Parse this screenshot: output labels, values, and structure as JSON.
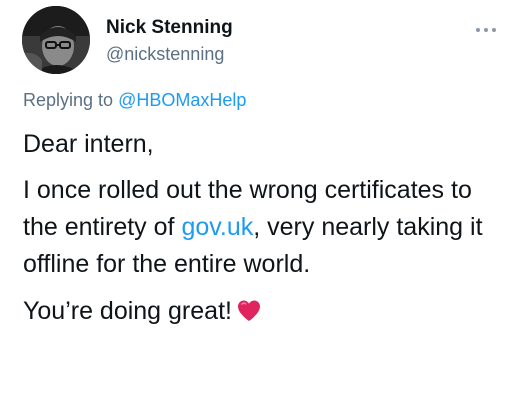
{
  "author": {
    "name": "Nick Stenning",
    "handle": "@nickstenning"
  },
  "reply": {
    "prefix": "Replying to",
    "mention": "@HBOMaxHelp"
  },
  "body": {
    "greeting": "Dear intern,",
    "para1_before_link": "I once rolled out the wrong certificates to the entirety of ",
    "link_text": "gov.uk",
    "para1_after_link": ", very nearly taking it offline for the entire world.",
    "closing": "You’re doing great!",
    "closing_emoji_icon": "red-heart-icon"
  },
  "colors": {
    "link": "#1d9bf0",
    "secondary_text": "#5b7083",
    "primary_text": "#0f1419",
    "heart": "#e0245e"
  }
}
